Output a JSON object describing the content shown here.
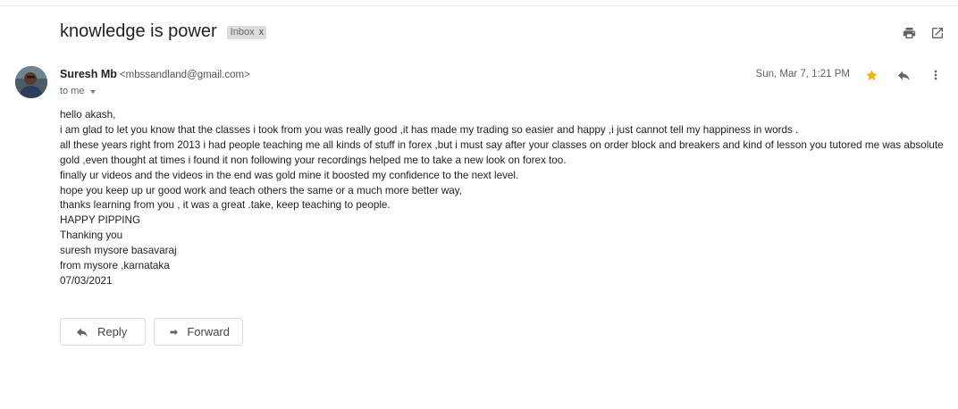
{
  "subject": "knowledge is power",
  "label": {
    "name": "Inbox",
    "remove": "x"
  },
  "top_icons": [
    "print-icon",
    "open-in-new-window-icon"
  ],
  "sender": {
    "name": "Suresh Mb",
    "email": "<mbssandland@gmail.com>",
    "to": "to me",
    "date": "Sun, Mar 7, 1:21 PM"
  },
  "message_icons": [
    "star-icon",
    "reply-icon",
    "more-vert-icon"
  ],
  "accent_colors": {
    "star": "#f4b400",
    "icon": "#5f6368"
  },
  "body_lines": [
    "hello akash,",
    "i am glad to let you know that the classes i took from you was really good ,it has made my trading so easier and happy ,i just  cannot tell my happiness in words .",
    "all these years right from 2013 i had people teaching me all kinds of stuff in forex ,but i must say after your classes on order block and breakers and kind of lesson you tutored me was absolute",
    "gold ,even thought at times i found it non following your recordings helped me to take a new look on forex too.",
    "finally ur videos and the videos in the end was gold mine it boosted my confidence to the next level.",
    "hope you keep up ur good work and teach others the same or a much more better way,",
    "thanks learning from you , it was a great .take, keep teaching to people.",
    "HAPPY PIPPING",
    "Thanking you",
    "suresh mysore basavaraj",
    "from mysore ,karnataka",
    "07/03/2021"
  ],
  "actions": {
    "reply": "Reply",
    "forward": "Forward"
  }
}
